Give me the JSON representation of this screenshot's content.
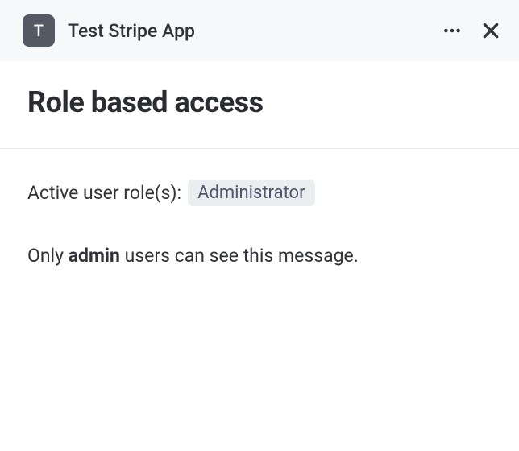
{
  "header": {
    "app_icon_letter": "T",
    "app_name": "Test Stripe App"
  },
  "title": "Role based access",
  "content": {
    "role_label": "Active user role(s):",
    "role_badge": "Administrator",
    "message_prefix": "Only ",
    "message_bold": "admin",
    "message_suffix": " users can see this message."
  }
}
